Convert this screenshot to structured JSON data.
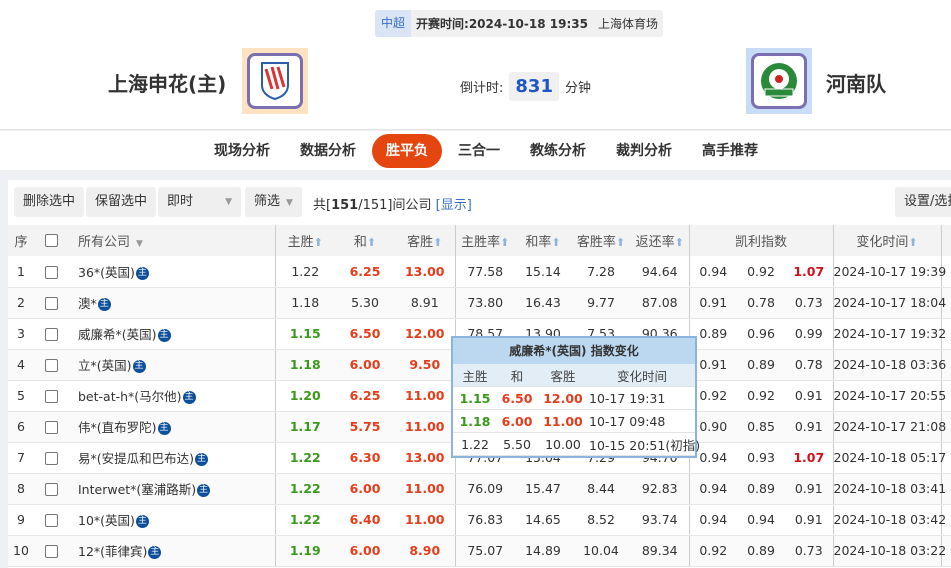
{
  "match": {
    "league": "中超",
    "kickoff_label": "开赛时间:",
    "kickoff": "2024-10-18 19:35",
    "venue": "上海体育场",
    "home": "上海申花(主)",
    "away": "河南队",
    "countdown_label": "倒计时:",
    "countdown": "831",
    "countdown_unit": "分钟"
  },
  "nav": [
    {
      "label": "现场分析"
    },
    {
      "label": "数据分析"
    },
    {
      "label": "胜平负",
      "active": true
    },
    {
      "label": "三合一"
    },
    {
      "label": "教练分析"
    },
    {
      "label": "裁判分析"
    },
    {
      "label": "高手推荐"
    }
  ],
  "toolbar": {
    "delete": "删除选中",
    "keep": "保留选中",
    "mode": "即时",
    "filter": "筛选",
    "count_prefix": "共[",
    "count_bold": "151",
    "count_rest": "/151]间公司",
    "show": "[显示]",
    "settings": "设置/选择"
  },
  "headers": {
    "idx": "序",
    "company": "所有公司",
    "home": "主胜",
    "draw": "和",
    "away": "客胜",
    "home_rate": "主胜率",
    "draw_rate": "和率",
    "away_rate": "客胜率",
    "return_rate": "返还率",
    "kelly": "凯利指数",
    "time": "变化时间"
  },
  "rows": [
    {
      "idx": "1",
      "company": "36*(英国)",
      "h": "1.22",
      "d": "6.25",
      "a": "13.00",
      "hc": "",
      "dc": "r",
      "ac": "r",
      "hr": "77.58",
      "dr": "15.14",
      "ar": "7.28",
      "rr": "94.64",
      "k1": "0.94",
      "k2": "0.92",
      "k3": "1.07",
      "k3c": "kr",
      "time": "2024-10-17 19:39"
    },
    {
      "idx": "2",
      "company": "澳*",
      "h": "1.18",
      "d": "5.30",
      "a": "8.91",
      "hc": "",
      "dc": "",
      "ac": "",
      "hr": "73.80",
      "dr": "16.43",
      "ar": "9.77",
      "rr": "87.08",
      "k1": "0.91",
      "k2": "0.78",
      "k3": "0.73",
      "k3c": "",
      "time": "2024-10-17 18:04"
    },
    {
      "idx": "3",
      "company": "威廉希*(英国)",
      "h": "1.15",
      "d": "6.50",
      "a": "12.00",
      "hc": "g",
      "dc": "r",
      "ac": "r",
      "hr": "78.57",
      "dr": "13.90",
      "ar": "7.53",
      "rr": "90.36",
      "k1": "0.89",
      "k2": "0.96",
      "k3": "0.99",
      "k3c": "",
      "time": "2024-10-17 19:32"
    },
    {
      "idx": "4",
      "company": "立*(英国)",
      "h": "1.18",
      "d": "6.00",
      "a": "9.50",
      "hc": "g",
      "dc": "r",
      "ac": "r",
      "hr": "",
      "dr": "",
      "ar": "",
      "rr": "",
      "k1": "0.91",
      "k2": "0.89",
      "k3": "0.78",
      "k3c": "",
      "time": "2024-10-18 03:36"
    },
    {
      "idx": "5",
      "company": "bet-at-h*(马尔他)",
      "h": "1.20",
      "d": "6.25",
      "a": "11.00",
      "hc": "g",
      "dc": "r",
      "ac": "r",
      "hr": "",
      "dr": "",
      "ar": "",
      "rr": "",
      "k1": "0.92",
      "k2": "0.92",
      "k3": "0.91",
      "k3c": "",
      "time": "2024-10-17 20:55"
    },
    {
      "idx": "6",
      "company": "伟*(直布罗陀)",
      "h": "1.17",
      "d": "5.75",
      "a": "11.00",
      "hc": "g",
      "dc": "r",
      "ac": "r",
      "hr": "",
      "dr": "",
      "ar": "",
      "rr": "",
      "k1": "0.90",
      "k2": "0.85",
      "k3": "0.91",
      "k3c": "",
      "time": "2024-10-17 21:08"
    },
    {
      "idx": "7",
      "company": "易*(安提瓜和巴布达)",
      "h": "1.22",
      "d": "6.30",
      "a": "13.00",
      "hc": "g",
      "dc": "r",
      "ac": "r",
      "hr": "77.07",
      "dr": "15.04",
      "ar": "7.29",
      "rr": "94.70",
      "k1": "0.94",
      "k2": "0.93",
      "k3": "1.07",
      "k3c": "kr",
      "time": "2024-10-18 05:17"
    },
    {
      "idx": "8",
      "company": "Interwet*(塞浦路斯)",
      "h": "1.22",
      "d": "6.00",
      "a": "11.00",
      "hc": "g",
      "dc": "r",
      "ac": "r",
      "hr": "76.09",
      "dr": "15.47",
      "ar": "8.44",
      "rr": "92.83",
      "k1": "0.94",
      "k2": "0.89",
      "k3": "0.91",
      "k3c": "",
      "time": "2024-10-18 03:41"
    },
    {
      "idx": "9",
      "company": "10*(英国)",
      "h": "1.22",
      "d": "6.40",
      "a": "11.00",
      "hc": "g",
      "dc": "r",
      "ac": "r",
      "hr": "76.83",
      "dr": "14.65",
      "ar": "8.52",
      "rr": "93.74",
      "k1": "0.94",
      "k2": "0.94",
      "k3": "0.91",
      "k3c": "",
      "time": "2024-10-18 03:42"
    },
    {
      "idx": "10",
      "company": "12*(菲律宾)",
      "h": "1.19",
      "d": "6.00",
      "a": "8.90",
      "hc": "g",
      "dc": "r",
      "ac": "r",
      "hr": "75.07",
      "dr": "14.89",
      "ar": "10.04",
      "rr": "89.34",
      "k1": "0.92",
      "k2": "0.89",
      "k3": "0.73",
      "k3c": "",
      "time": "2024-10-18 03:22"
    }
  ],
  "badge": "主",
  "popup": {
    "title": "威廉希*(英国) 指数变化",
    "headers": [
      "主胜",
      "和",
      "客胜",
      "变化时间"
    ],
    "rows": [
      {
        "h": "1.15",
        "d": "6.50",
        "a": "12.00",
        "t": "10-17 19:31",
        "c": true
      },
      {
        "h": "1.18",
        "d": "6.00",
        "a": "11.00",
        "t": "10-17 09:48",
        "c": true
      },
      {
        "h": "1.22",
        "d": "5.50",
        "a": "10.00",
        "t": "10-15 20:51(初指)",
        "c": false
      }
    ]
  },
  "colors": {
    "accent": "#e5450f",
    "green": "#3a9a1c",
    "red": "#e53c1a",
    "blue": "#1f56c3"
  }
}
